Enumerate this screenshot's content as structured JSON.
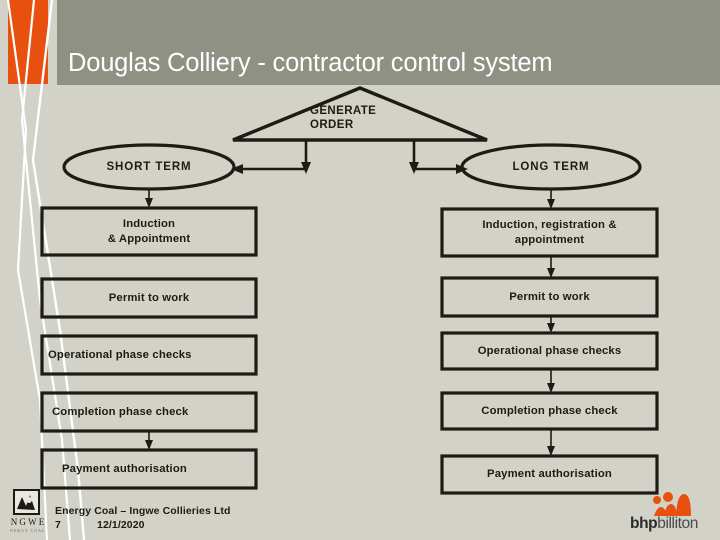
{
  "slide": {
    "title": "Douglas Colliery - contractor control system",
    "background_color": "#d2d2c8",
    "header_color": "#8e9184",
    "accent_color": "#e8500f",
    "line_color": "#1c1c14"
  },
  "diagram": {
    "type": "flowchart",
    "root": {
      "shape": "triangle",
      "label_line1": "GENERATE",
      "label_line2": "ORDER"
    },
    "branches": [
      {
        "id": "short-term",
        "shape": "ellipse",
        "label": "SHORT TERM",
        "steps": [
          "Induction\n& Appointment",
          "Permit to work",
          "Operational phase checks",
          "Completion phase  check",
          "Payment authorisation"
        ],
        "steps_display": [
          {
            "line1": "Induction",
            "line2": "& Appointment"
          },
          {
            "line1": "Permit to work",
            "line2": ""
          },
          {
            "line1": "Operational phase checks",
            "line2": ""
          },
          {
            "line1": "Completion phase  check",
            "line2": ""
          },
          {
            "line1": "Payment authorisation",
            "line2": ""
          }
        ]
      },
      {
        "id": "long-term",
        "shape": "ellipse",
        "label": "LONG TERM",
        "steps": [
          "Induction, registration &\nappointment",
          "Permit to work",
          "Operational phase checks",
          "Completion phase check",
          "Payment authorisation"
        ],
        "steps_display": [
          {
            "line1": "Induction, registration &",
            "line2": "appointment"
          },
          {
            "line1": "Permit to work",
            "line2": ""
          },
          {
            "line1": "Operational phase checks",
            "line2": ""
          },
          {
            "line1": "Completion phase check",
            "line2": ""
          },
          {
            "line1": "Payment authorisation",
            "line2": ""
          }
        ]
      }
    ]
  },
  "footer": {
    "company": "Energy Coal – Ingwe Collieries Ltd",
    "page_number": "7",
    "date": "12/1/2020",
    "left_logo": "ingwe-logo",
    "right_logo": "bhp-billiton-logo",
    "right_logo_text_bold": "bhp",
    "right_logo_text_light": "billiton"
  }
}
